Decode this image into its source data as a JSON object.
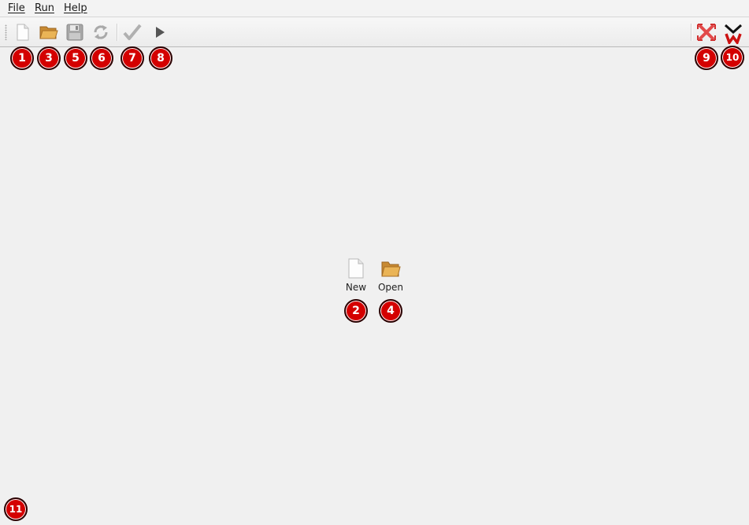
{
  "menu": {
    "file": "File",
    "run": "Run",
    "help": "Help"
  },
  "toolbar": {
    "new_icon": "new-document-icon",
    "open_icon": "open-folder-icon",
    "save_icon": "save-disk-icon",
    "reload_icon": "reload-icon",
    "validate_icon": "checkmark-icon",
    "run_icon": "play-icon",
    "fullscreen_icon": "fullscreen-cross-icon",
    "logo_icon": "app-logo-icon"
  },
  "center": {
    "new_label": "New",
    "open_label": "Open"
  },
  "badges": [
    "1",
    "2",
    "3",
    "4",
    "5",
    "6",
    "7",
    "8",
    "9",
    "10",
    "11"
  ],
  "colors": {
    "badge": "#d40000",
    "accent": "#e0a040",
    "logo": "#cc1111"
  }
}
